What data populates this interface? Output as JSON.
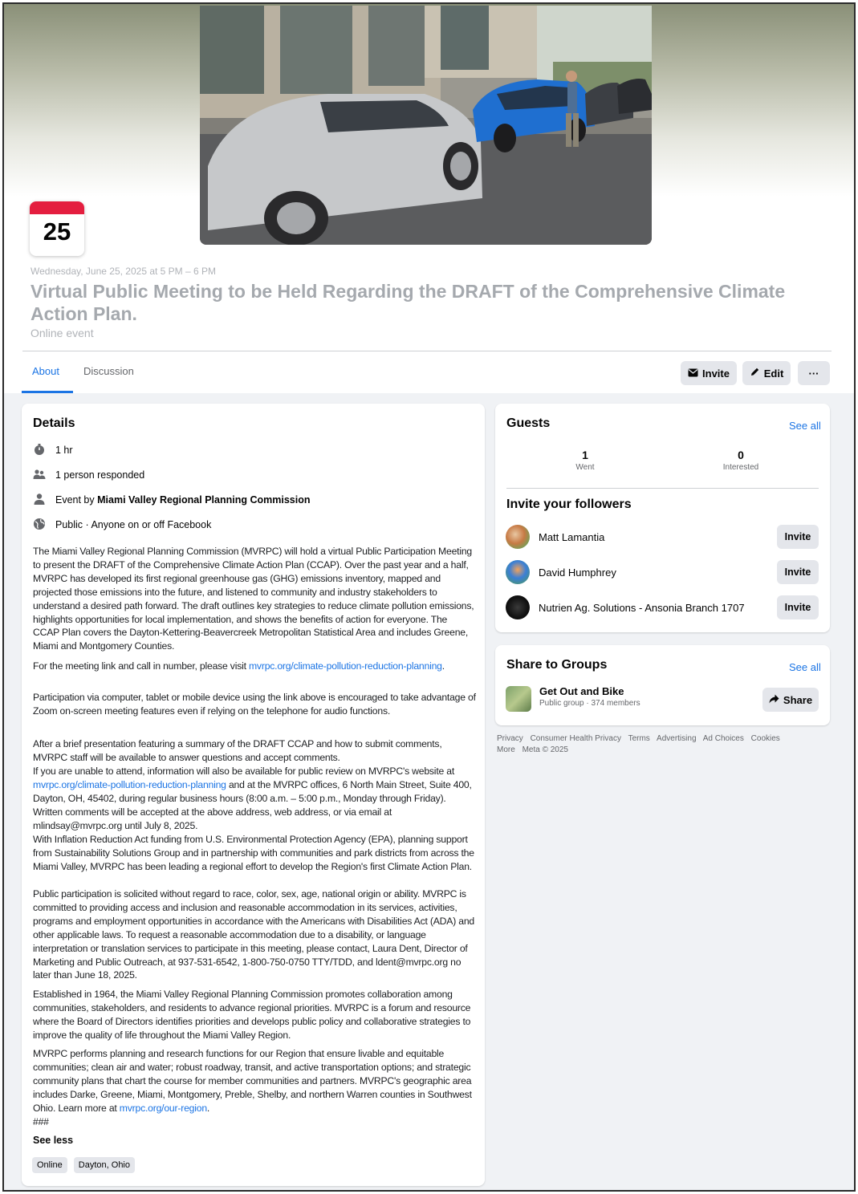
{
  "event": {
    "calendar_day": "25",
    "date_time": "Wednesday, June 25, 2025 at 5 PM – 6 PM",
    "title": "Virtual Public Meeting to be Held Regarding the DRAFT of the Comprehensive Climate Action Plan.",
    "kind": "Online event"
  },
  "tabs": [
    {
      "label": "About",
      "active": true
    },
    {
      "label": "Discussion",
      "active": false
    }
  ],
  "header_buttons": {
    "invite": "Invite",
    "edit": "Edit",
    "more": "···"
  },
  "details": {
    "title": "Details",
    "duration": "1 hr",
    "responded": "1 person responded",
    "event_by_prefix": "Event by",
    "organizer": "Miami Valley Regional Planning Commission",
    "privacy": "Public · Anyone on or off Facebook",
    "paragraphs": [
      "The Miami Valley Regional Planning Commission (MVRPC) will hold a virtual Public Participation Meeting to present the DRAFT of the Comprehensive Climate Action Plan (CCAP). Over the past year and a half, MVRPC has developed its first regional greenhouse gas (GHG) emissions inventory, mapped and projected those emissions into the future, and listened to community and industry stakeholders to understand a desired path forward. The draft outlines key strategies to reduce climate pollution emissions, highlights opportunities for local implementation, and shows the benefits of action for everyone. The CCAP Plan covers the Dayton-Kettering-Beavercreek Metropolitan Statistical Area and includes Greene, Miami and Montgomery Counties."
    ],
    "meeting_link_prefix": "For the meeting link and call in number, please visit",
    "meeting_link": "mvrpc.org/climate-pollution-reduction-planning",
    "meeting_link_suffix": ".",
    "participation": "Participation via computer, tablet or mobile device using the link above is encouraged to take advantage of Zoom on-screen meeting features even if relying on the telephone for audio functions.",
    "after_presentation": "After a brief presentation featuring a summary of the DRAFT CCAP and how to submit comments, MVRPC staff will be available to answer questions and accept comments.",
    "unable_prefix": "If you are unable to attend, information will also be available for public review on MVRPC's website at",
    "unable_link": "mvrpc.org/climate-pollution-reduction-planning",
    "unable_suffix": "and at the MVRPC offices, 6 North Main Street, Suite 400, Dayton, OH, 45402, during regular business hours (8:00 a.m. – 5:00 p.m., Monday through Friday). Written comments will be accepted at the above address, web address, or via email at mlindsay@mvrpc.org until July 8, 2025.",
    "ira": "With Inflation Reduction Act funding from U.S. Environmental Protection Agency (EPA), planning support from Sustainability Solutions Group and in partnership with communities and park districts from across the Miami Valley, MVRPC has been leading a regional effort to develop the Region's first Climate Action Plan.",
    "public_participation": "Public participation is solicited without regard to race, color, sex, age, national origin or ability. MVRPC is committed to providing access and inclusion and reasonable accommodation in its services, activities, programs and employment opportunities in accordance with the Americans with Disabilities Act (ADA) and other applicable laws. To request a reasonable accommodation due to a disability, or language interpretation or translation services to participate in this meeting, please contact, Laura Dent, Director of Marketing and Public Outreach, at 937-531-6542, 1-800-750-0750 TTY/TDD, and ldent@mvrpc.org no later than June 18, 2025.",
    "established": "Established in 1964, the Miami Valley Regional Planning Commission promotes collaboration among communities, stakeholders, and residents to advance regional priorities. MVRPC is a forum and resource where the Board of Directors identifies priorities and develops public policy and collaborative strategies to improve the quality of life throughout the Miami Valley Region.",
    "performs_prefix": "MVRPC performs planning and research functions for our Region that ensure livable and equitable communities; clean air and water; robust roadway, transit, and active transportation options; and strategic community plans that chart the course for member communities and partners. MVRPC's geographic area includes Darke, Greene, Miami, Montgomery, Preble, Shelby, and northern Warren counties in Southwest Ohio. Learn more at",
    "performs_link": "mvrpc.org/our-region",
    "performs_suffix": ".",
    "hashes": "###",
    "see_less": "See less",
    "tags": [
      "Online",
      "Dayton, Ohio"
    ]
  },
  "guests": {
    "title": "Guests",
    "see_all": "See all",
    "went_count": "1",
    "went_label": "Went",
    "interested_count": "0",
    "interested_label": "Interested",
    "invite_title": "Invite your followers",
    "followers": [
      {
        "name": "Matt Lamantia",
        "button": "Invite"
      },
      {
        "name": "David Humphrey",
        "button": "Invite"
      },
      {
        "name": "Nutrien Ag. Solutions - Ansonia Branch 1707",
        "button": "Invite"
      }
    ]
  },
  "share": {
    "title": "Share to Groups",
    "see_all": "See all",
    "group_name": "Get Out and Bike",
    "group_meta": "Public group · 374 members",
    "button": "Share"
  },
  "footer": {
    "links": [
      "Privacy",
      "Consumer Health Privacy",
      "Terms",
      "Advertising",
      "Ad Choices",
      "Cookies"
    ],
    "more": "More",
    "meta": "Meta © 2025"
  },
  "colors": {
    "accent": "#1b74e4",
    "calendar_red": "#e41e3f",
    "button_gray": "#e4e6eb",
    "page_bg": "#f0f2f5"
  }
}
